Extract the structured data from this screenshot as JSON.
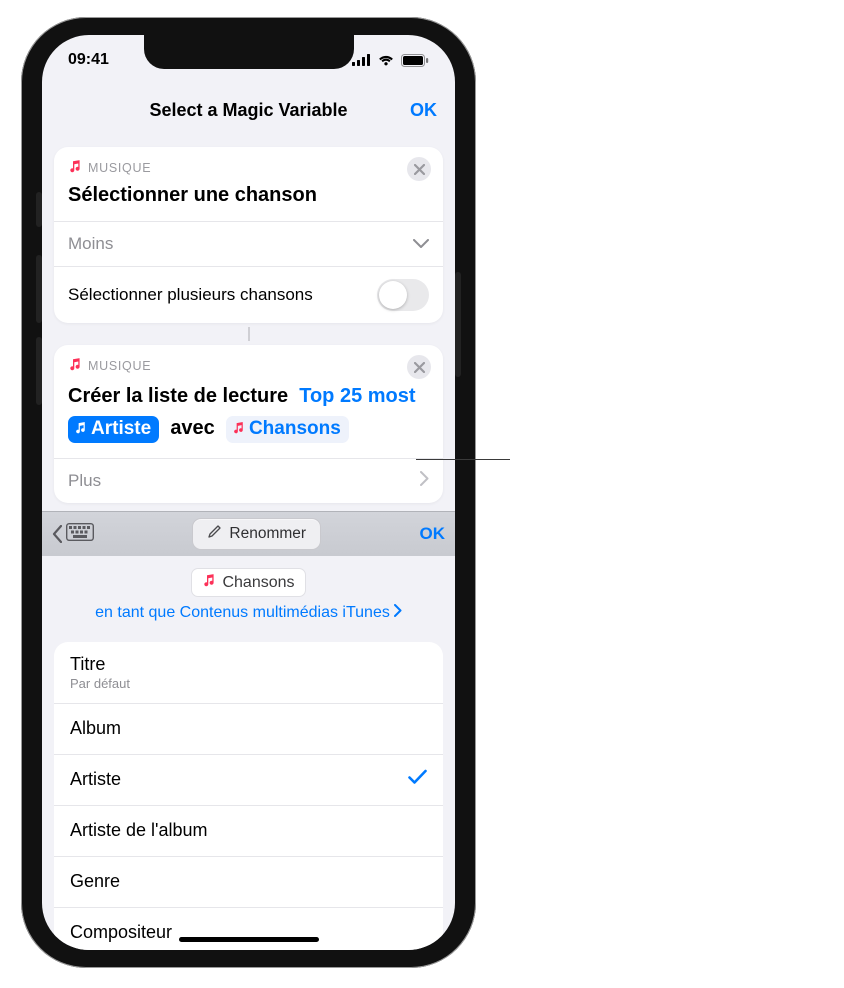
{
  "status": {
    "time": "09:41"
  },
  "nav": {
    "title": "Select a Magic Variable",
    "ok": "OK"
  },
  "card1": {
    "app": "MUSIQUE",
    "title": "Sélectionner une chanson",
    "row_less": "Moins",
    "row_multi": "Sélectionner plusieurs chansons"
  },
  "card2": {
    "app": "MUSIQUE",
    "action": "Créer la liste de lecture",
    "name_part1": "Top 25",
    "name_part2": "most",
    "artist_token": "Artiste",
    "with": "avec",
    "input_token": "Chansons",
    "row_more": "Plus"
  },
  "accessory": {
    "rename": "Renommer",
    "ok": "OK"
  },
  "var_detail": {
    "chip": "Chansons",
    "type": "en tant que Contenus multimédias iTunes"
  },
  "attributes": {
    "items": [
      {
        "title": "Titre",
        "sub": "Par défaut",
        "selected": false
      },
      {
        "title": "Album",
        "selected": false
      },
      {
        "title": "Artiste",
        "selected": true
      },
      {
        "title": "Artiste de l'album",
        "selected": false
      },
      {
        "title": "Genre",
        "selected": false
      },
      {
        "title": "Compositeur",
        "selected": false
      }
    ]
  }
}
